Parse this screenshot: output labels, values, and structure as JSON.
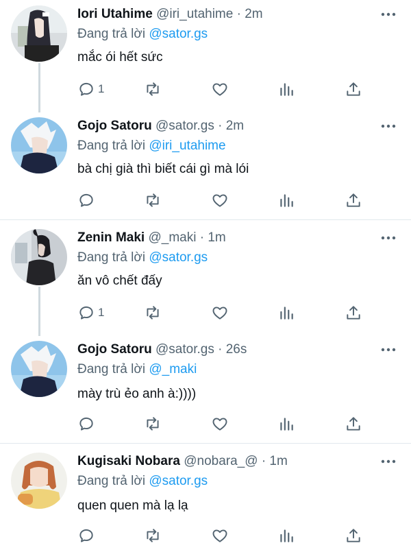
{
  "reply_prefix": "Đang trả lời",
  "tweets": [
    {
      "name": "Iori Utahime",
      "handle": "@iri_utahime",
      "separator": "·",
      "time": "2m",
      "replying_to": "@sator.gs",
      "text": "mắc ói hết sức",
      "reply_count": "1"
    },
    {
      "name": "Gojo Satoru",
      "handle": "@sator.gs",
      "separator": "·",
      "time": "2m",
      "replying_to": "@iri_utahime",
      "text": "bà chị già thì biết cái gì mà lói",
      "reply_count": ""
    },
    {
      "name": "Zenin Maki",
      "handle": "@_maki",
      "separator": "·",
      "time": "1m",
      "replying_to": "@sator.gs",
      "text": "ăn vô chết đấy",
      "reply_count": "1"
    },
    {
      "name": "Gojo Satoru",
      "handle": "@sator.gs",
      "separator": "·",
      "time": "26s",
      "replying_to": "@_maki",
      "text": "mày trù ẻo anh à:))))",
      "reply_count": ""
    },
    {
      "name": "Kugisaki Nobara",
      "handle": "@nobara_@",
      "separator": "·",
      "time": "1m",
      "replying_to": "@sator.gs",
      "text": "quen quen mà lạ lạ",
      "reply_count": ""
    }
  ],
  "colors": {
    "link": "#1d9bf0",
    "muted": "#536471",
    "text": "#0f1419",
    "thread_line": "#cfd9de"
  },
  "icons": [
    "reply-icon",
    "retweet-icon",
    "like-icon",
    "analytics-icon",
    "share-icon",
    "more-icon"
  ]
}
